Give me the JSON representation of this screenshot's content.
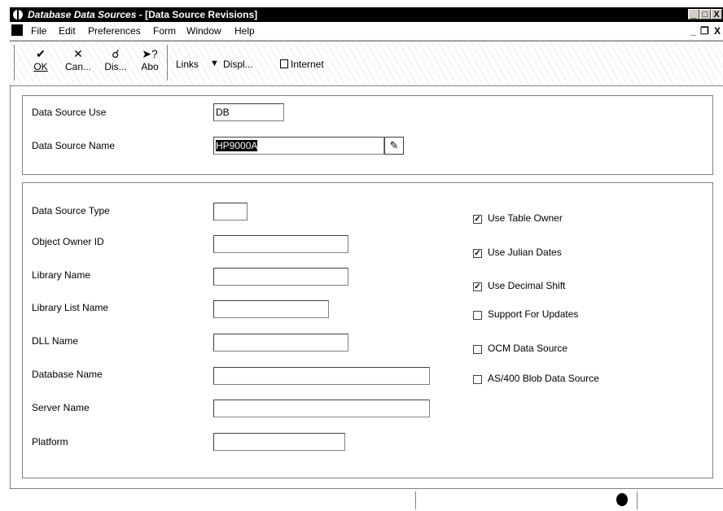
{
  "window": {
    "app_title": "Database Data Sources",
    "form_title": " - [Data Source Revisions]",
    "min_label": "_",
    "max_label": "□",
    "close_label": "X"
  },
  "menu": {
    "file": "File",
    "edit": "Edit",
    "preferences": "Preferences",
    "form": "Form",
    "window": "Window",
    "help": "Help",
    "child_min": "_",
    "child_restore": "❐",
    "child_close": "X"
  },
  "toolbar": {
    "ok": "OK",
    "cancel": "Can...",
    "display": "Dis...",
    "about": "Abo",
    "links": "Links",
    "display_menu": "Displ...",
    "internet": "Internet"
  },
  "header_group": {
    "use_label": "Data Source Use",
    "use_value": "DB",
    "name_label": "Data Source Name",
    "name_value": "HP9000A"
  },
  "details": {
    "type_label": "Data Source Type",
    "type_value": "",
    "owner_label": "Object Owner ID",
    "owner_value": "",
    "library_label": "Library Name",
    "library_value": "",
    "liblist_label": "Library List Name",
    "liblist_value": "",
    "dll_label": "DLL Name",
    "dll_value": "",
    "dbname_label": "Database Name",
    "dbname_value": "",
    "server_label": "Server Name",
    "server_value": "",
    "platform_label": "Platform",
    "platform_value": ""
  },
  "options": [
    {
      "label": "Use Table Owner",
      "checked": true
    },
    {
      "label": "Use Julian Dates",
      "checked": true
    },
    {
      "label": "Use Decimal Shift",
      "checked": true
    },
    {
      "label": "Support For Updates",
      "checked": false
    },
    {
      "label": "OCM Data Source",
      "checked": false
    },
    {
      "label": "AS/400 Blob Data Source",
      "checked": false
    }
  ],
  "check_mark": "✓"
}
